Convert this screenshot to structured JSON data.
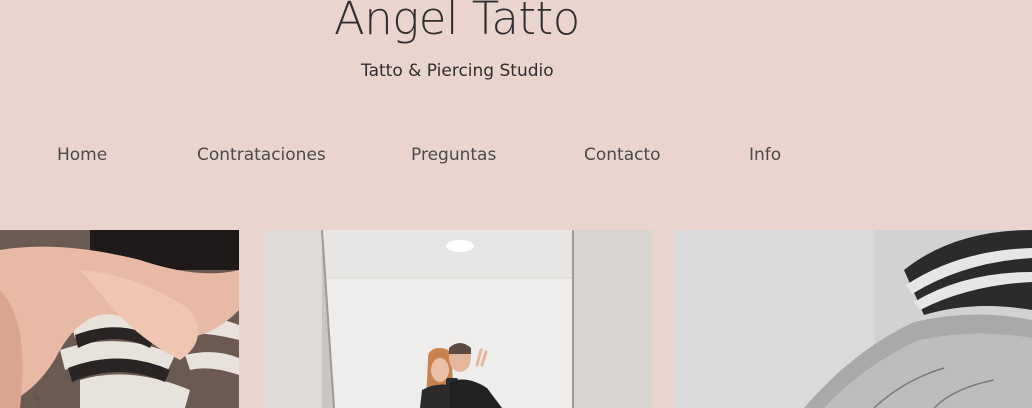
{
  "site": {
    "title": "Angel Tatto",
    "subtitle": "Tatto & Piercing Studio"
  },
  "nav": {
    "items": [
      {
        "label": "Home"
      },
      {
        "label": "Contrataciones"
      },
      {
        "label": "Preguntas"
      },
      {
        "label": "Contacto"
      },
      {
        "label": "Info"
      }
    ]
  },
  "colors": {
    "background": "#ead4ce",
    "text": "#3a3a3a"
  }
}
